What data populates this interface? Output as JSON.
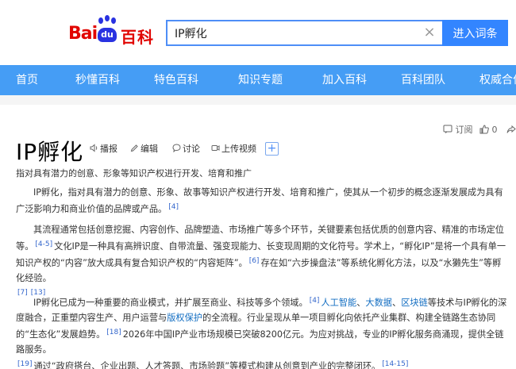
{
  "search": {
    "value": "IP孵化",
    "clear_glyph": "×",
    "button_label": "进入词条"
  },
  "logo": {
    "bai": "Bai",
    "du": "du",
    "baike": "百科"
  },
  "nav": {
    "items": [
      "首页",
      "秒懂百科",
      "特色百科",
      "知识专题",
      "加入百科",
      "百科团队",
      "权威合作"
    ]
  },
  "tools": {
    "subscribe_label": "订阅",
    "like_count": "0",
    "share_icon": "share-icon"
  },
  "entry": {
    "title": "IP孵化",
    "actions": {
      "broadcast": "播报",
      "edit": "编辑",
      "discuss": "讨论",
      "upload_video": "上传视频"
    },
    "subtitle": "指对具有潜力的创意、形象等知识产权进行开发、培育和推广"
  },
  "paragraphs": {
    "p1": {
      "text": "IP孵化，指对具有潜力的创意、形象、故事等知识产权进行开发、培育和推广，使其从一个初步的概念逐渐发展成为具有广泛影响力和商业价值的品牌或产品。",
      "ref": "[4]"
    },
    "p2": {
      "text_a": "其流程通常包括创意挖掘、内容创作、品牌塑造、市场推广等多个环节，关键要素包括优质的创意内容、精准的市场定位等。",
      "ref_a": "[4-5]",
      "text_b": "文化IP是一种具有高辨识度、自带流量、强变现能力、长变现周期的文化符号。学术上，“孵化IP”是将一个具有单一知识产权的“内容”放大成具有复合知识产权的“内容矩阵”。",
      "ref_b": "[6]",
      "text_c": "存在如“六步操盘法”等系统化孵化方法，以及“水獭先生”等孵化经验。",
      "ref_c": "[7]",
      "ref_d": "[13]"
    },
    "p3": {
      "text_a": "IP孵化已成为一种重要的商业模式，并扩展至商业、科技等多个领域。",
      "ref_a": "[4]",
      "link_ai": "人工智能",
      "sep1": "、",
      "link_bigdata": "大数据",
      "sep2": "、",
      "link_blockchain": "区块链",
      "text_b": "等技术与IP孵化的深度融合，正重塑内容生产、用户运营与",
      "link_copyright": "版权保护",
      "text_c": "的全流程。行业呈现从单一项目孵化向依托产业集群、构建全链路生态协同的“生态化”发展趋势。",
      "ref_b": "[18]",
      "text_d": "2026年中国IP产业市场规模已突破8200亿元。为应对挑战，专业的IP孵化服务商涌现，提供全链路服务。",
      "ref_c": "[19]",
      "text_e": "通过“政府搭台、企业出题、人才答题、市场验题”等模式构建从创意到产业的完整闭环。",
      "ref_d": "[14-15]"
    }
  }
}
